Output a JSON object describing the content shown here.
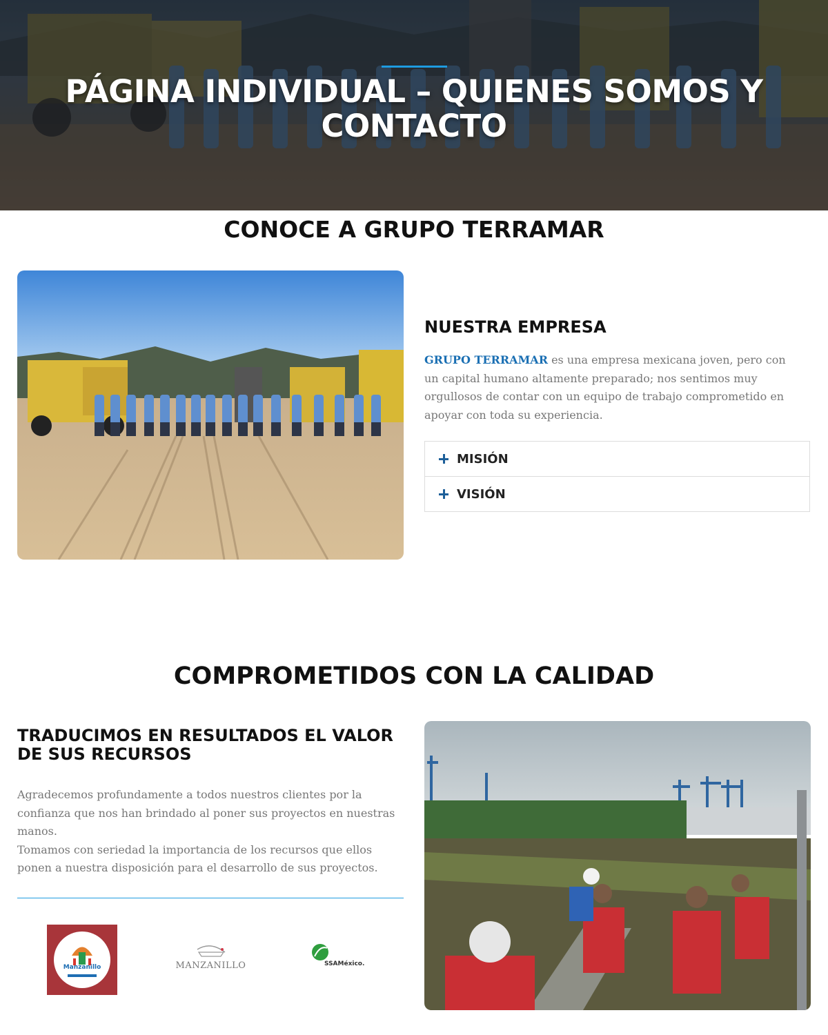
{
  "hero": {
    "title": "PÁGINA INDIVIDUAL – QUIENES SOMOS Y CONTACTO"
  },
  "about": {
    "section_title": "CONOCE A GRUPO TERRAMAR",
    "heading": "NUESTRA EMPRESA",
    "brand": "GRUPO TERRAMAR",
    "text": " es una empresa mexicana joven, pero con un capital humano altamente preparado; nos sentimos muy orgullosos de contar con un equipo de trabajo comprometido en apoyar con toda su experiencia.",
    "accordion": [
      {
        "label": "MISIÓN"
      },
      {
        "label": "VISIÓN"
      }
    ]
  },
  "quality": {
    "section_title": "COMPROMETIDOS CON LA CALIDAD",
    "heading": "TRADUCIMOS EN RESULTADOS EL VALOR DE SUS RECURSOS",
    "paragraph1": "Agradecemos profundamente a todos nuestros clientes por la confianza que nos han brindado al poner sus proyectos en nuestras manos.",
    "paragraph2": "Tomamos con seriedad la importancia de los recursos que ellos ponen a nuestra disposición para el desarrollo de sus proyectos."
  },
  "logos": {
    "manzanillo_city": "Manzanillo",
    "port": "MANZANILLO",
    "ssa": "SSAMéxico."
  },
  "colors": {
    "accent": "#1e9be0",
    "brand_blue": "#1a6fb3",
    "plus_icon": "#1d5f99",
    "body_text": "#777777"
  }
}
